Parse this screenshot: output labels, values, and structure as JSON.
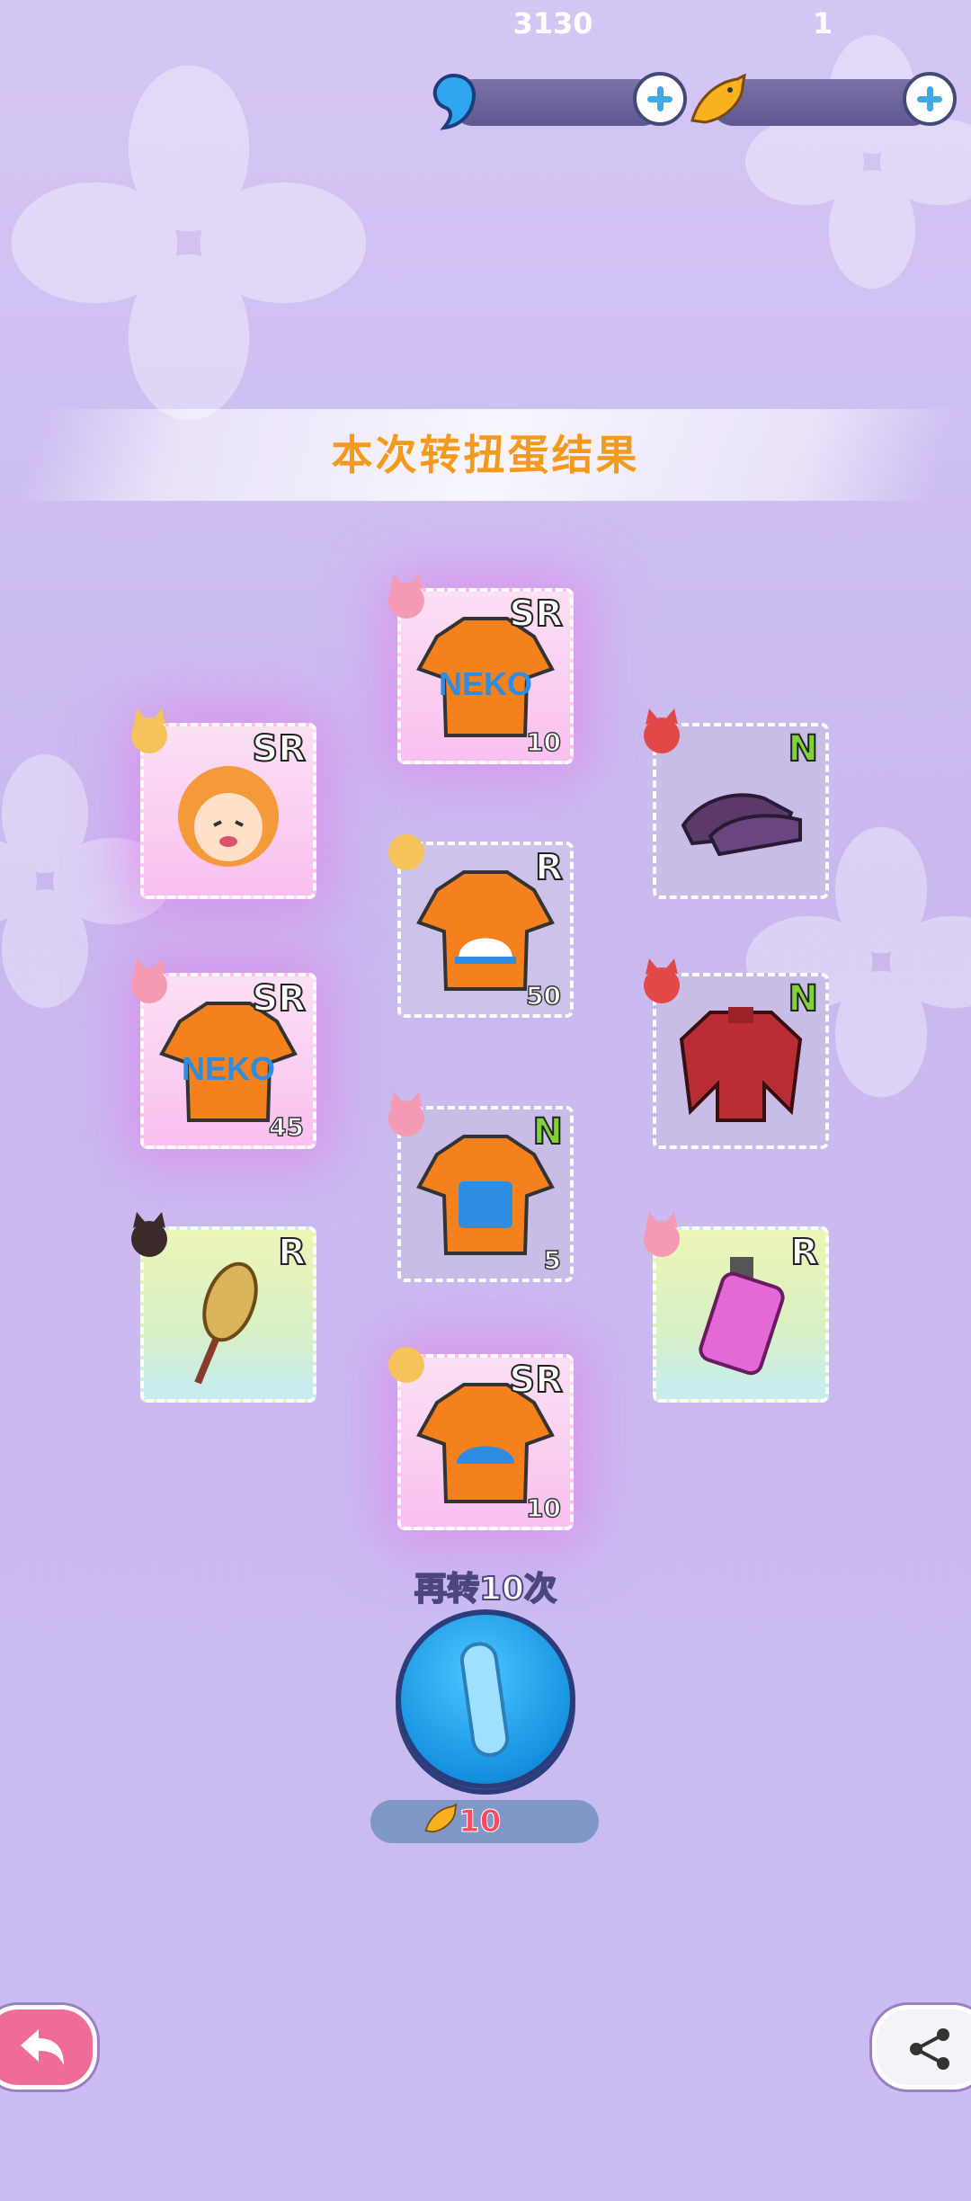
{
  "currency": {
    "gems": {
      "icon": "blue-gem-icon",
      "value": "3130"
    },
    "fish": {
      "icon": "golden-fish-icon",
      "value": "1"
    }
  },
  "title": "本次转扭蛋结果",
  "results": [
    {
      "rarity": "SR",
      "item": "NEKO orange t-shirt",
      "count": "10",
      "avatar": "pink-cat-girl"
    },
    {
      "rarity": "SR",
      "item": "orange-hair girl portrait",
      "count": "",
      "avatar": "blonde-fox-girl"
    },
    {
      "rarity": "N",
      "item": "purple sandals",
      "count": "",
      "avatar": "red-cat-girl"
    },
    {
      "rarity": "R",
      "item": "bell orange t-shirt",
      "count": "50",
      "avatar": "blonde-girl"
    },
    {
      "rarity": "SR",
      "item": "NEKO orange t-shirt",
      "count": "45",
      "avatar": "pink-cat-girl"
    },
    {
      "rarity": "N",
      "item": "red sweater",
      "count": "",
      "avatar": "red-cat-girl"
    },
    {
      "rarity": "N",
      "item": "text orange t-shirt",
      "count": "5",
      "avatar": "pink-cat-girl"
    },
    {
      "rarity": "R",
      "item": "corn skewer",
      "count": "",
      "avatar": "dark-hair-girl"
    },
    {
      "rarity": "R",
      "item": "perfume bottle",
      "count": "",
      "avatar": "pink-cat-girl"
    },
    {
      "rarity": "SR",
      "item": "cat orange t-shirt",
      "count": "10",
      "avatar": "blonde-girl"
    }
  ],
  "spin": {
    "label": "再转10次",
    "cost": "10",
    "cost_icon": "golden-fish-icon"
  },
  "buttons": {
    "back": "back-arrow-icon",
    "share": "share-icon"
  },
  "colors": {
    "title": "#f39a1c",
    "sr_glow": "#e278eb",
    "n_text": "#7fd23a",
    "spin": "#1692e0",
    "cost": "#ff4a5f"
  }
}
